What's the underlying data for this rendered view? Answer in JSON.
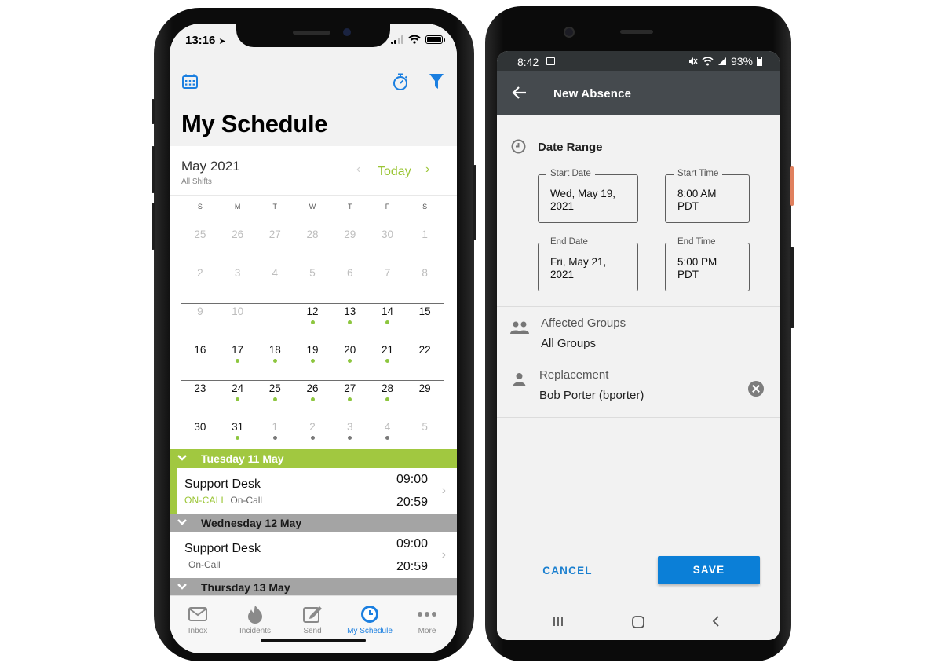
{
  "ios": {
    "status": {
      "time": "13:16"
    },
    "title": "My Schedule",
    "calendar": {
      "month": "May 2021",
      "subtitle": "All Shifts",
      "prev_glyph": "‹",
      "today_label": "Today",
      "next_glyph": "›",
      "weekdays": [
        "S",
        "M",
        "T",
        "W",
        "T",
        "F",
        "S"
      ],
      "weeks": [
        [
          {
            "d": "25",
            "dim": true,
            "dot": ""
          },
          {
            "d": "26",
            "dim": true,
            "dot": ""
          },
          {
            "d": "27",
            "dim": true,
            "dot": ""
          },
          {
            "d": "28",
            "dim": true,
            "dot": ""
          },
          {
            "d": "29",
            "dim": true,
            "dot": ""
          },
          {
            "d": "30",
            "dim": true,
            "dot": ""
          },
          {
            "d": "1",
            "dim": true,
            "dot": ""
          }
        ],
        [
          {
            "d": "2",
            "dim": true,
            "dot": ""
          },
          {
            "d": "3",
            "dim": true,
            "dot": ""
          },
          {
            "d": "4",
            "dim": true,
            "dot": ""
          },
          {
            "d": "5",
            "dim": true,
            "dot": ""
          },
          {
            "d": "6",
            "dim": true,
            "dot": ""
          },
          {
            "d": "7",
            "dim": true,
            "dot": ""
          },
          {
            "d": "8",
            "dim": true,
            "dot": ""
          }
        ],
        [
          {
            "d": "9",
            "dim": true,
            "dot": ""
          },
          {
            "d": "10",
            "dim": true,
            "dot": ""
          },
          {
            "d": "",
            "dim": false,
            "dot": ""
          },
          {
            "d": "12",
            "dim": false,
            "dot": "green"
          },
          {
            "d": "13",
            "dim": false,
            "dot": "green"
          },
          {
            "d": "14",
            "dim": false,
            "dot": "green"
          },
          {
            "d": "15",
            "dim": false,
            "dot": ""
          }
        ],
        [
          {
            "d": "16",
            "dim": false,
            "dot": ""
          },
          {
            "d": "17",
            "dim": false,
            "dot": "green"
          },
          {
            "d": "18",
            "dim": false,
            "dot": "green"
          },
          {
            "d": "19",
            "dim": false,
            "dot": "green"
          },
          {
            "d": "20",
            "dim": false,
            "dot": "green"
          },
          {
            "d": "21",
            "dim": false,
            "dot": "green"
          },
          {
            "d": "22",
            "dim": false,
            "dot": ""
          }
        ],
        [
          {
            "d": "23",
            "dim": false,
            "dot": ""
          },
          {
            "d": "24",
            "dim": false,
            "dot": "green"
          },
          {
            "d": "25",
            "dim": false,
            "dot": "green"
          },
          {
            "d": "26",
            "dim": false,
            "dot": "green"
          },
          {
            "d": "27",
            "dim": false,
            "dot": "green"
          },
          {
            "d": "28",
            "dim": false,
            "dot": "green"
          },
          {
            "d": "29",
            "dim": false,
            "dot": ""
          }
        ],
        [
          {
            "d": "30",
            "dim": false,
            "dot": ""
          },
          {
            "d": "31",
            "dim": false,
            "dot": "green"
          },
          {
            "d": "1",
            "dim": true,
            "dot": "grey"
          },
          {
            "d": "2",
            "dim": true,
            "dot": "grey"
          },
          {
            "d": "3",
            "dim": true,
            "dot": "grey"
          },
          {
            "d": "4",
            "dim": true,
            "dot": "grey"
          },
          {
            "d": "5",
            "dim": true,
            "dot": ""
          }
        ]
      ]
    },
    "agenda": {
      "day1": "Tuesday 11 May",
      "item1": {
        "name": "Support Desk",
        "tag": "ON-CALL",
        "role": "On-Call",
        "start": "09:00",
        "end": "20:59"
      },
      "day2": "Wednesday 12 May",
      "item2": {
        "name": "Support Desk",
        "role": "On-Call",
        "start": "09:00",
        "end": "20:59"
      },
      "day3": "Thursday 13 May"
    },
    "tabs": {
      "inbox": "Inbox",
      "incidents": "Incidents",
      "send": "Send",
      "schedule": "My Schedule",
      "more": "More"
    },
    "colors": {
      "accent": "#1b7fe0",
      "green": "#a1c840"
    }
  },
  "android": {
    "status": {
      "time": "8:42",
      "battery": "93%"
    },
    "appbar": {
      "title": "New Absence"
    },
    "date_range": {
      "title": "Date Range",
      "start_date_label": "Start Date",
      "start_date": "Wed, May 19,\n2021",
      "start_time_label": "Start Time",
      "start_time": "8:00 AM\nPDT",
      "end_date_label": "End Date",
      "end_date": "Fri, May 21,\n2021",
      "end_time_label": "End Time",
      "end_time": "5:00 PM\nPDT"
    },
    "groups": {
      "label": "Affected Groups",
      "value": "All Groups"
    },
    "replacement": {
      "label": "Replacement",
      "value": "Bob Porter (bporter)"
    },
    "actions": {
      "cancel": "CANCEL",
      "save": "SAVE"
    },
    "colors": {
      "primary": "#0b7fd7",
      "appbar": "#454a4e"
    }
  }
}
